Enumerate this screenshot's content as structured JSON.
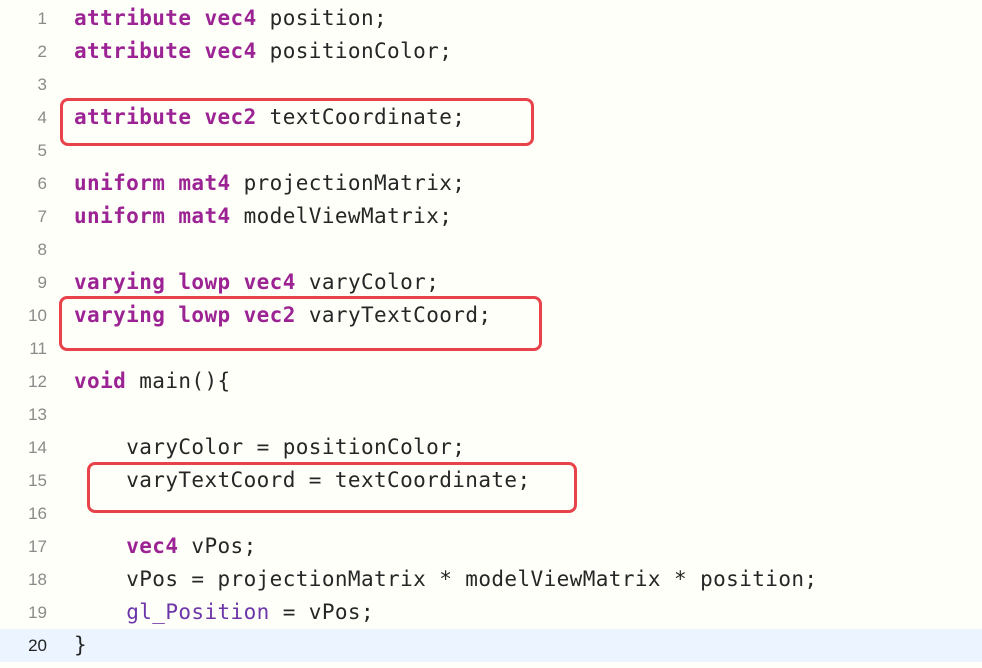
{
  "editor": {
    "current_line": 20,
    "lines": [
      {
        "num": "1",
        "indent": "",
        "tokens": [
          {
            "t": "attribute",
            "c": "kw"
          },
          {
            "t": " "
          },
          {
            "t": "vec4",
            "c": "kw"
          },
          {
            "t": " position;"
          }
        ]
      },
      {
        "num": "2",
        "indent": "",
        "tokens": [
          {
            "t": "attribute",
            "c": "kw"
          },
          {
            "t": " "
          },
          {
            "t": "vec4",
            "c": "kw"
          },
          {
            "t": " positionColor;"
          }
        ]
      },
      {
        "num": "3",
        "indent": "",
        "tokens": []
      },
      {
        "num": "4",
        "indent": "",
        "tokens": [
          {
            "t": "attribute",
            "c": "kw"
          },
          {
            "t": " "
          },
          {
            "t": "vec2",
            "c": "kw"
          },
          {
            "t": " textCoordinate;"
          }
        ]
      },
      {
        "num": "5",
        "indent": "",
        "tokens": []
      },
      {
        "num": "6",
        "indent": "",
        "tokens": [
          {
            "t": "uniform",
            "c": "kw"
          },
          {
            "t": " "
          },
          {
            "t": "mat4",
            "c": "kw"
          },
          {
            "t": " projectionMatrix;"
          }
        ]
      },
      {
        "num": "7",
        "indent": "",
        "tokens": [
          {
            "t": "uniform",
            "c": "kw"
          },
          {
            "t": " "
          },
          {
            "t": "mat4",
            "c": "kw"
          },
          {
            "t": " modelViewMatrix;"
          }
        ]
      },
      {
        "num": "8",
        "indent": "",
        "tokens": []
      },
      {
        "num": "9",
        "indent": "",
        "tokens": [
          {
            "t": "varying",
            "c": "kw"
          },
          {
            "t": " "
          },
          {
            "t": "lowp",
            "c": "kw"
          },
          {
            "t": " "
          },
          {
            "t": "vec4",
            "c": "kw"
          },
          {
            "t": " varyColor;"
          }
        ]
      },
      {
        "num": "10",
        "indent": "",
        "tokens": [
          {
            "t": "varying",
            "c": "kw"
          },
          {
            "t": " "
          },
          {
            "t": "lowp",
            "c": "kw"
          },
          {
            "t": " "
          },
          {
            "t": "vec2",
            "c": "kw"
          },
          {
            "t": " varyTextCoord;"
          }
        ]
      },
      {
        "num": "11",
        "indent": "",
        "tokens": []
      },
      {
        "num": "12",
        "indent": "",
        "tokens": [
          {
            "t": "void",
            "c": "kw"
          },
          {
            "t": " main(){"
          }
        ]
      },
      {
        "num": "13",
        "indent": "",
        "tokens": []
      },
      {
        "num": "14",
        "indent": "    ",
        "tokens": [
          {
            "t": "varyColor = positionColor;"
          }
        ]
      },
      {
        "num": "15",
        "indent": "    ",
        "tokens": [
          {
            "t": "varyTextCoord = textCoordinate;"
          }
        ]
      },
      {
        "num": "16",
        "indent": "",
        "tokens": []
      },
      {
        "num": "17",
        "indent": "    ",
        "tokens": [
          {
            "t": "vec4",
            "c": "kw"
          },
          {
            "t": " vPos;"
          }
        ]
      },
      {
        "num": "18",
        "indent": "    ",
        "tokens": [
          {
            "t": "vPos = projectionMatrix * modelViewMatrix * position;"
          }
        ]
      },
      {
        "num": "19",
        "indent": "    ",
        "tokens": [
          {
            "t": "gl_Position",
            "c": "builtin"
          },
          {
            "t": " = vPos;"
          }
        ]
      },
      {
        "num": "20",
        "indent": "",
        "tokens": [
          {
            "t": "}"
          }
        ]
      }
    ]
  },
  "colors": {
    "background": "#fffff9",
    "keyword": "#9b2393",
    "builtin": "#6c36a9",
    "plain_text": "#262626",
    "line_number": "#8a8a8a",
    "current_line_background": "#ecf5ff",
    "highlight_box_border": "#e8434b"
  }
}
